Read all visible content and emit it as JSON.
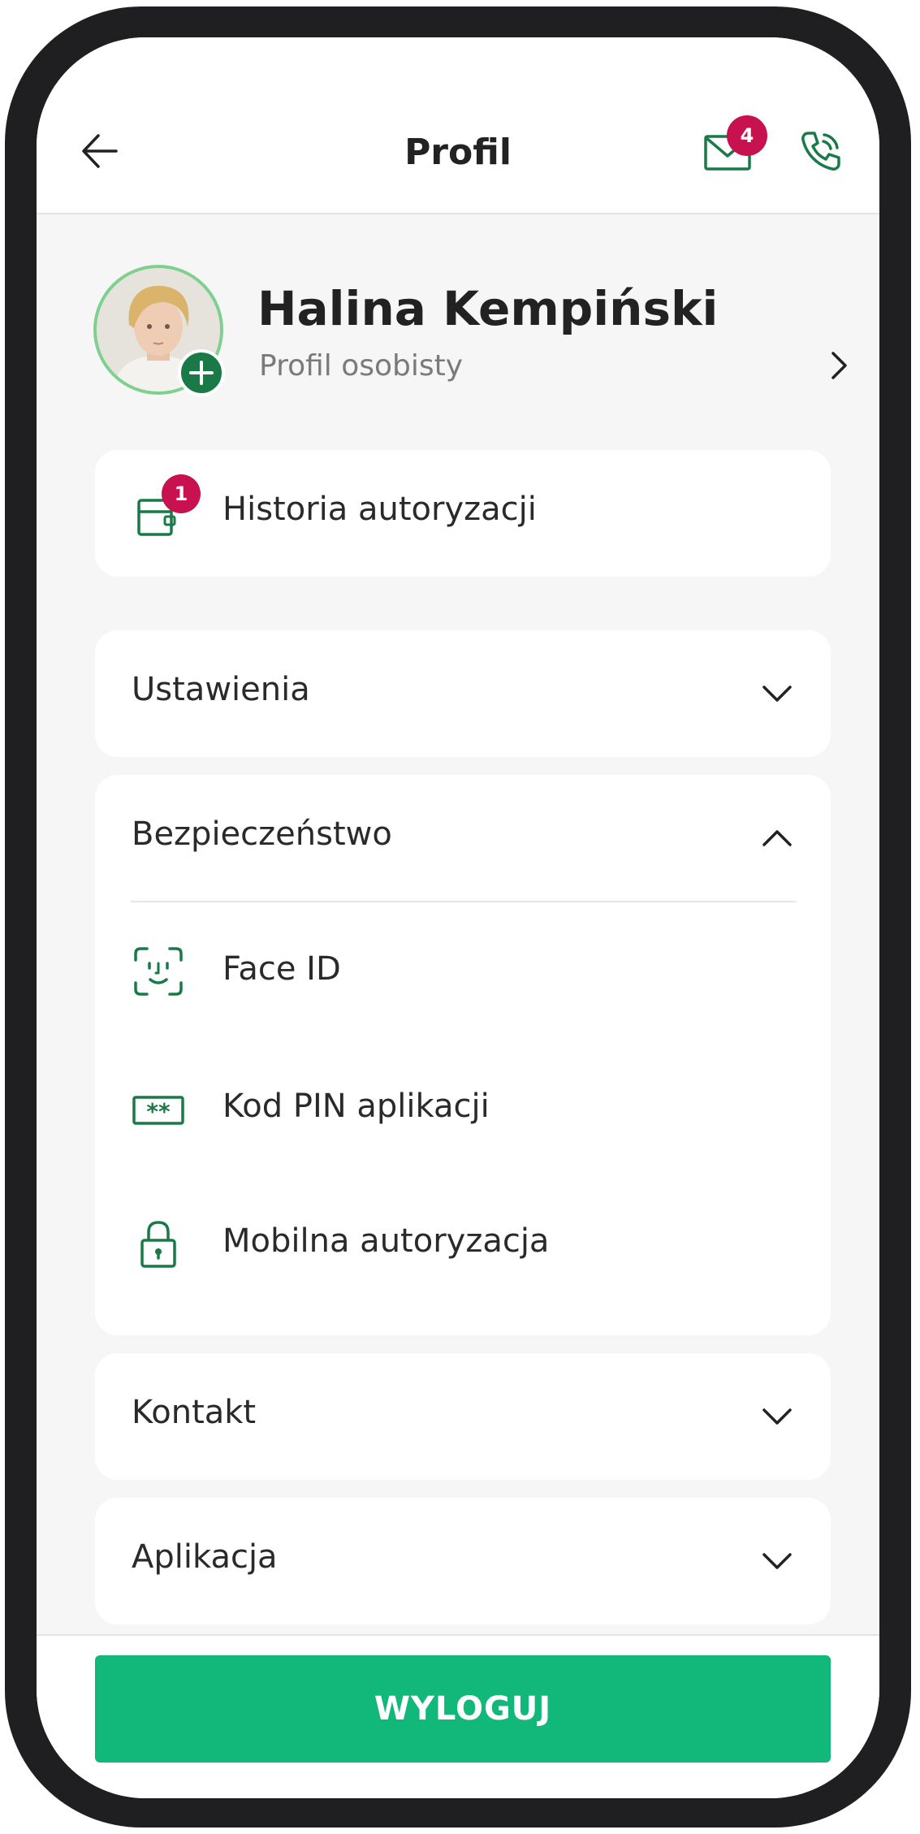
{
  "header": {
    "title": "Profil",
    "mail_badge_count": "4",
    "back_icon": "arrow-left-icon",
    "mail_icon": "envelope-icon",
    "phone_icon": "phone-call-icon"
  },
  "profile": {
    "name": "Halina Kempiński",
    "subtitle": "Profil osobisty",
    "add_icon": "plus-icon"
  },
  "authorization_history": {
    "label": "Historia autoryzacji",
    "badge_count": "1",
    "icon": "wallet-icon"
  },
  "sections": {
    "settings": {
      "label": "Ustawienia",
      "expanded": false
    },
    "security": {
      "label": "Bezpieczeństwo",
      "expanded": true,
      "items": [
        {
          "label": "Face ID",
          "icon": "face-id-icon"
        },
        {
          "label": "Kod PIN aplikacji",
          "icon": "pin-code-icon"
        },
        {
          "label": "Mobilna autoryzacja",
          "icon": "lock-icon"
        }
      ]
    },
    "contact": {
      "label": "Kontakt",
      "expanded": false
    },
    "application": {
      "label": "Aplikacja",
      "expanded": false
    }
  },
  "footer": {
    "logout_label": "WYLOGUJ"
  },
  "colors": {
    "accent_green": "#12b87a",
    "icon_green": "#1a7a47",
    "badge_red": "#c8114f",
    "background": "#f6f6f6"
  }
}
